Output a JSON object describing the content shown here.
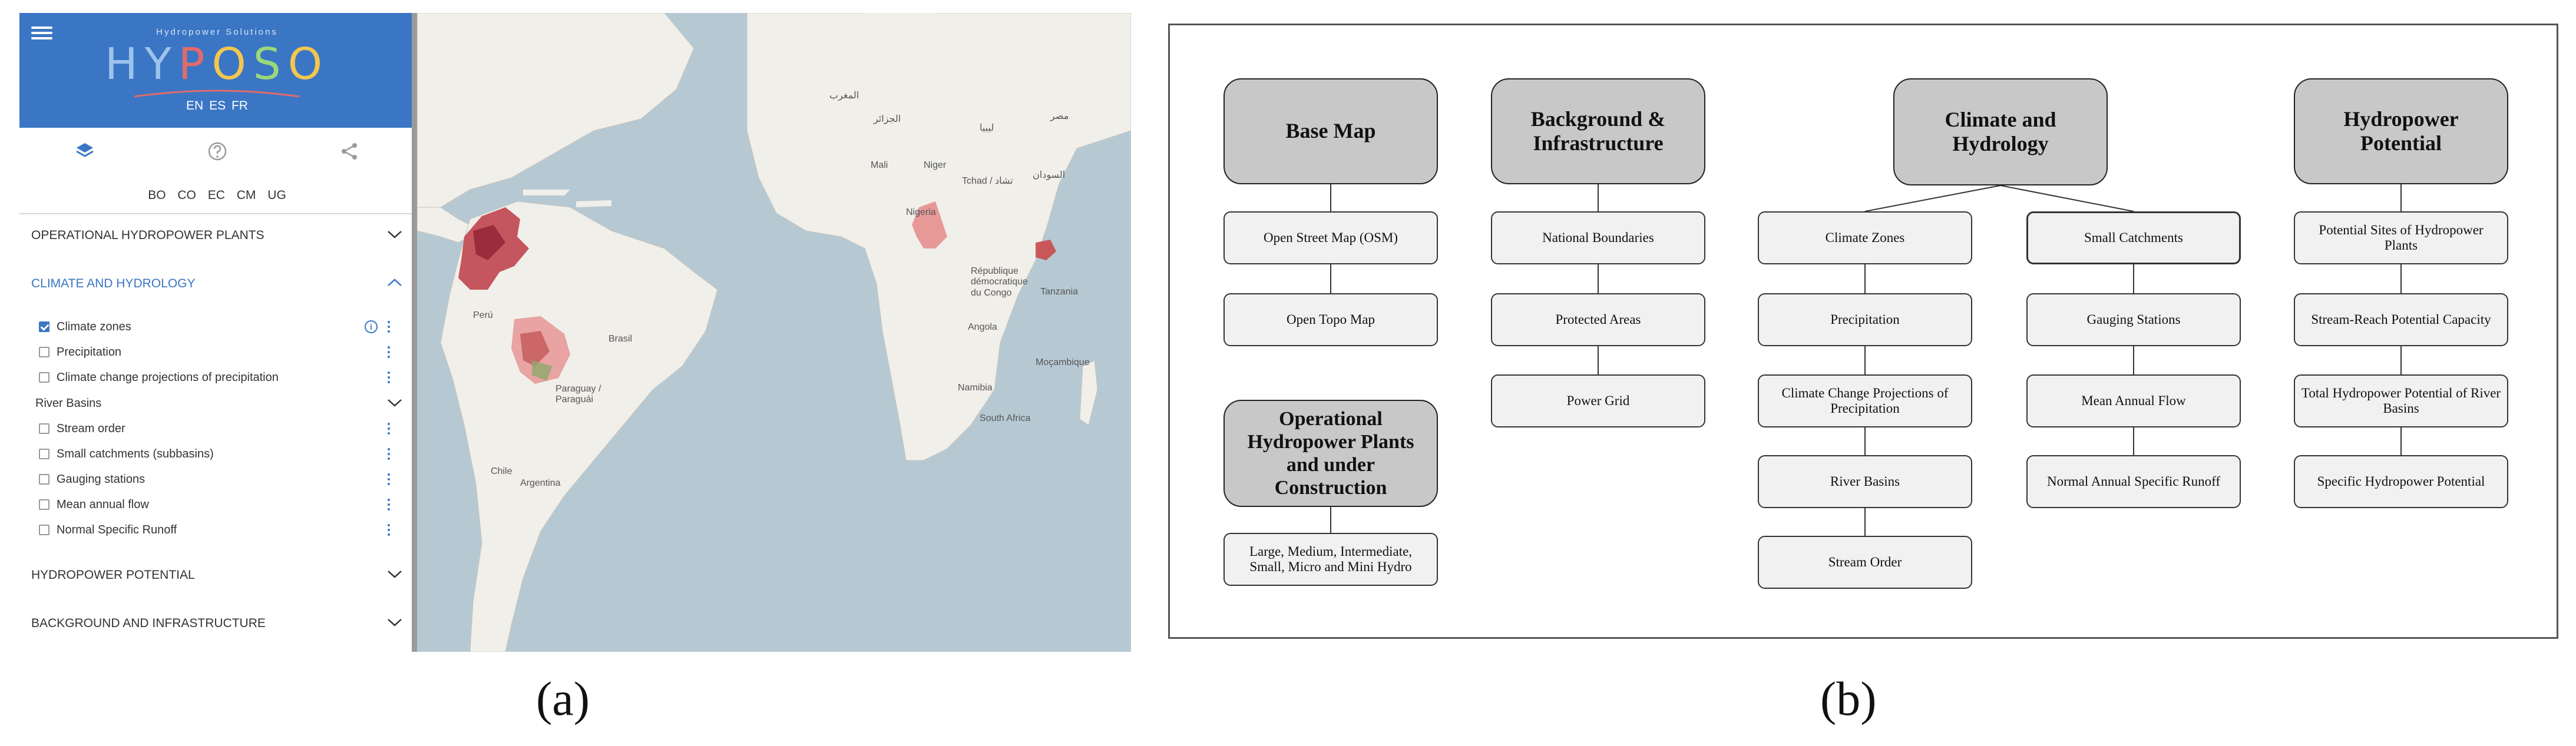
{
  "app": {
    "brand_subtitle": "Hydropower Solutions",
    "brand_name": "HYPOSO",
    "languages": [
      "EN",
      "ES",
      "FR"
    ],
    "countries": [
      "BO",
      "CO",
      "EC",
      "CM",
      "UG"
    ]
  },
  "toolbar": {
    "icons": [
      "layers-icon",
      "help-icon",
      "share-icon"
    ]
  },
  "sections": {
    "operational": "OPERATIONAL HYDROPOWER PLANTS",
    "climate": "CLIMATE AND HYDROLOGY",
    "hydropower": "HYDROPOWER POTENTIAL",
    "background": "BACKGROUND AND INFRASTRUCTURE"
  },
  "climate_layers": [
    {
      "label": "Climate zones",
      "checked": true
    },
    {
      "label": "Precipitation",
      "checked": false
    },
    {
      "label": "Climate change projections of precipitation",
      "checked": false
    }
  ],
  "river_basins_group": "River Basins",
  "river_layers": [
    {
      "label": "Stream order",
      "checked": false
    },
    {
      "label": "Small catchments (subbasins)",
      "checked": false
    },
    {
      "label": "Gauging stations",
      "checked": false
    },
    {
      "label": "Mean annual flow",
      "checked": false
    },
    {
      "label": "Normal Specific Runoff",
      "checked": false
    }
  ],
  "map_labels": {
    "peru": "Perú",
    "brasil": "Brasil",
    "paraguay": "Paraguay /\nParaguái",
    "chile": "Chile",
    "argentina": "Argentina",
    "mali": "Mali",
    "niger": "Niger",
    "tchad": "Tchad / تشاد",
    "nigeria": "Nigeria",
    "rdc": "République\ndémocratique\ndu Congo",
    "tanzania": "Tanzania",
    "angola": "Angola",
    "mocambique": "Moçambique",
    "namibia": "Namibia",
    "south_africa": "South Africa",
    "algeria": "الجزائر",
    "morocco": "المغرب",
    "egypt": "مصر",
    "libya": "ليبيا",
    "sudan": "السودان"
  },
  "captions": {
    "a": "(a)",
    "b": "(b)"
  },
  "diagram": {
    "base_map": {
      "title": "Base Map",
      "items": [
        "Open Street Map  (OSM)",
        "Open Topo Map"
      ]
    },
    "operational": {
      "title": "Operational Hydropower Plants and  under Construction",
      "items": [
        "Large, Medium, Intermediate, Small, Micro  and Mini Hydro"
      ]
    },
    "background": {
      "title": "Background & Infrastructure",
      "items": [
        "National Boundaries",
        "Protected Areas",
        "Power Grid"
      ]
    },
    "climate": {
      "title": "Climate and Hydrology",
      "left_items": [
        "Climate Zones",
        "Precipitation",
        "Climate Change Projections of Precipitation",
        "River Basins",
        "Stream Order"
      ],
      "right_items": [
        "Small Catchments",
        "Gauging Stations",
        "Mean Annual Flow",
        "Normal Annual  Specific Runoff"
      ]
    },
    "hydropower": {
      "title": "Hydropower Potential",
      "items": [
        "Potential Sites  of Hydropower Plants",
        "Stream-Reach Potential Capacity",
        "Total Hydropower  Potential of River Basins",
        "Specific Hydropower  Potential"
      ]
    }
  }
}
